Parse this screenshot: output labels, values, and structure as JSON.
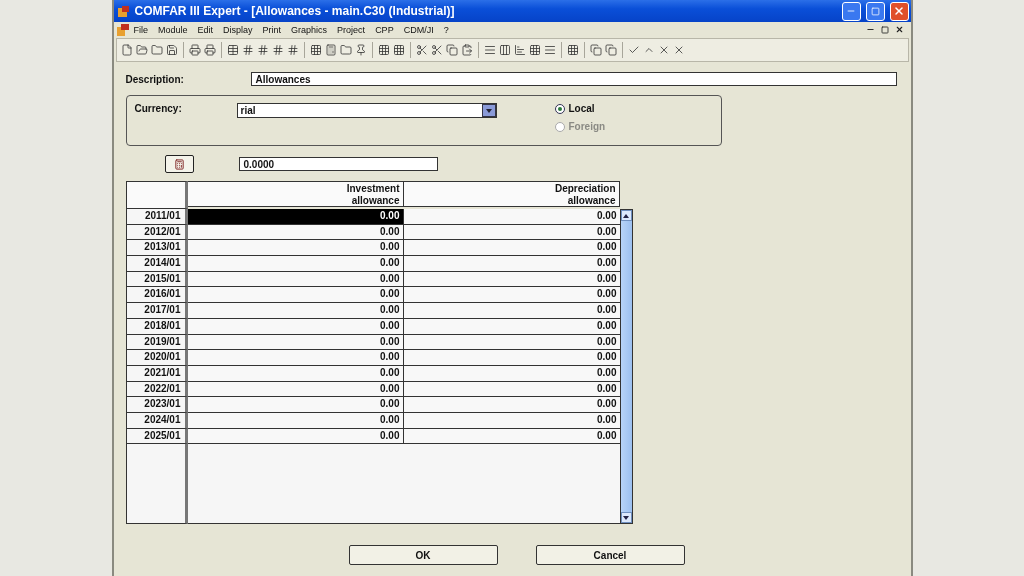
{
  "window": {
    "title": "COMFAR III Expert - [Allowances - main.C30 (Industrial)]"
  },
  "menu": [
    "File",
    "Module",
    "Edit",
    "Display",
    "Print",
    "Graphics",
    "Project",
    "CPP",
    "CDM/JI",
    "?"
  ],
  "description": {
    "label": "Description:",
    "value": "Allowances"
  },
  "currency": {
    "label": "Currency:",
    "value": "rial",
    "options": [
      {
        "label": "Local",
        "selected": true,
        "disabled": false
      },
      {
        "label": "Foreign",
        "selected": false,
        "disabled": true
      }
    ]
  },
  "rate": {
    "value": "0.0000"
  },
  "table": {
    "columns": [
      "Investment allowance",
      "Depreciation allowance"
    ],
    "rows": [
      {
        "label": "2011/01",
        "cells": [
          {
            "value": "0.00",
            "selected": true
          },
          {
            "value": "0.00",
            "selected": false
          }
        ]
      },
      {
        "label": "2012/01",
        "cells": [
          {
            "value": "0.00",
            "selected": false
          },
          {
            "value": "0.00",
            "selected": false
          }
        ]
      },
      {
        "label": "2013/01",
        "cells": [
          {
            "value": "0.00",
            "selected": false
          },
          {
            "value": "0.00",
            "selected": false
          }
        ]
      },
      {
        "label": "2014/01",
        "cells": [
          {
            "value": "0.00",
            "selected": false
          },
          {
            "value": "0.00",
            "selected": false
          }
        ]
      },
      {
        "label": "2015/01",
        "cells": [
          {
            "value": "0.00",
            "selected": false
          },
          {
            "value": "0.00",
            "selected": false
          }
        ]
      },
      {
        "label": "2016/01",
        "cells": [
          {
            "value": "0.00",
            "selected": false
          },
          {
            "value": "0.00",
            "selected": false
          }
        ]
      },
      {
        "label": "2017/01",
        "cells": [
          {
            "value": "0.00",
            "selected": false
          },
          {
            "value": "0.00",
            "selected": false
          }
        ]
      },
      {
        "label": "2018/01",
        "cells": [
          {
            "value": "0.00",
            "selected": false
          },
          {
            "value": "0.00",
            "selected": false
          }
        ]
      },
      {
        "label": "2019/01",
        "cells": [
          {
            "value": "0.00",
            "selected": false
          },
          {
            "value": "0.00",
            "selected": false
          }
        ]
      },
      {
        "label": "2020/01",
        "cells": [
          {
            "value": "0.00",
            "selected": false
          },
          {
            "value": "0.00",
            "selected": false
          }
        ]
      },
      {
        "label": "2021/01",
        "cells": [
          {
            "value": "0.00",
            "selected": false
          },
          {
            "value": "0.00",
            "selected": false
          }
        ]
      },
      {
        "label": "2022/01",
        "cells": [
          {
            "value": "0.00",
            "selected": false
          },
          {
            "value": "0.00",
            "selected": false
          }
        ]
      },
      {
        "label": "2023/01",
        "cells": [
          {
            "value": "0.00",
            "selected": false
          },
          {
            "value": "0.00",
            "selected": false
          }
        ]
      },
      {
        "label": "2024/01",
        "cells": [
          {
            "value": "0.00",
            "selected": false
          },
          {
            "value": "0.00",
            "selected": false
          }
        ]
      },
      {
        "label": "2025/01",
        "cells": [
          {
            "value": "0.00",
            "selected": false
          },
          {
            "value": "0.00",
            "selected": false
          }
        ]
      }
    ]
  },
  "buttons": [
    "OK",
    "Cancel"
  ]
}
